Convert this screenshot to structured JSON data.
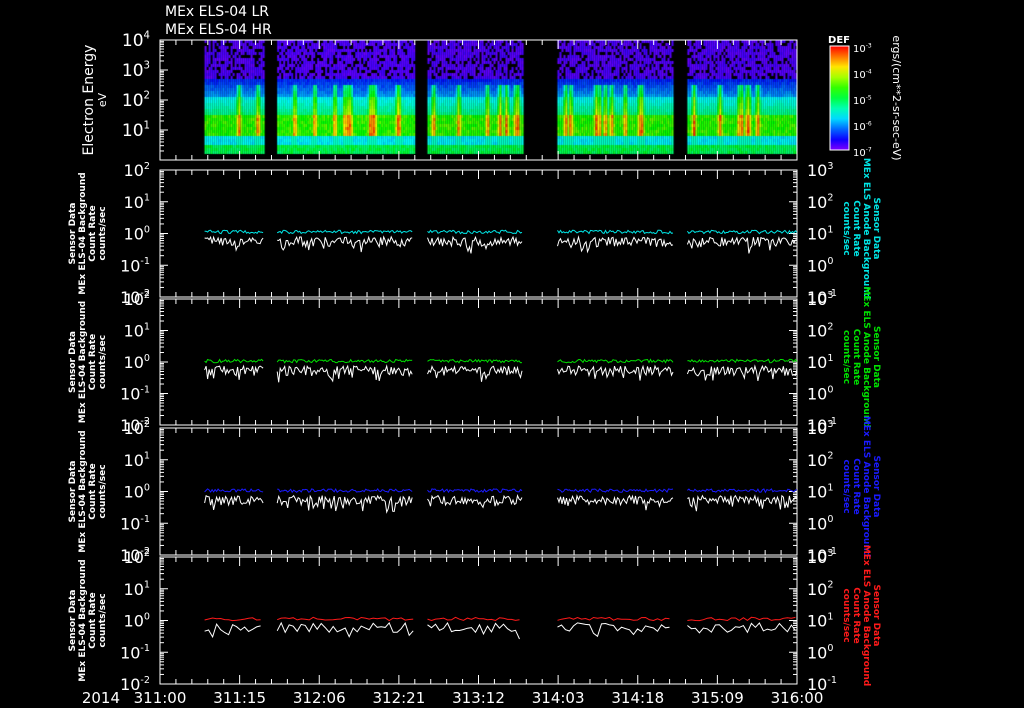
{
  "titles": [
    "MEx ELS-04 LR",
    "MEx ELS-04 HR"
  ],
  "colors": {
    "background": "#000000",
    "axis": "#ffffff",
    "background_series": "#ffffff"
  },
  "chart_data": [
    {
      "type": "heatmap",
      "name": "spectrogram",
      "ylabel": "Electron Energy",
      "yunits": "eV",
      "yscale": "log",
      "ylim": [
        1,
        10000
      ],
      "yticks": [
        "10^4",
        "10^3",
        "10^2",
        "10^1"
      ],
      "colorbar": {
        "label": "DEF",
        "units": "ergs/(cm**2-sr-sec-eV)",
        "range": [
          1e-07,
          0.001
        ],
        "ticks": [
          "10^-3",
          "10^-4",
          "10^-5",
          "10^-6",
          "10^-7"
        ]
      },
      "data_segments_doy": [
        [
          311.35,
          311.82
        ],
        [
          311.92,
          312.99
        ],
        [
          313.1,
          313.85
        ],
        [
          314.12,
          315.03
        ],
        [
          315.14,
          316.0
        ]
      ],
      "typical_levels": {
        "core_band_eV": [
          8,
          40
        ],
        "core_def": 1e-05,
        "upper_band_eV": [
          40,
          300
        ],
        "upper_def": 1e-06,
        "spike_peak_def": 0.001
      }
    },
    {
      "type": "line",
      "name": "panel-cyan",
      "left_label": [
        "Sensor Data",
        "MEx ELS-04 Background",
        "Count Rate",
        "counts/sec"
      ],
      "right_label": [
        "Sensor Data",
        "MEx ELS Anode Background",
        "Count Rate",
        "counts/sec"
      ],
      "color": "#00e5e5",
      "yscale": "log",
      "ylim": [
        0.01,
        100
      ],
      "yticks": [
        "10^2",
        "10^1",
        "10^0",
        "10^-1",
        "10^-2"
      ],
      "ylim_right": [
        0.1,
        1000
      ],
      "yticks_right": [
        "10^3",
        "10^2",
        "10^1",
        "10^0",
        "10^-1"
      ],
      "series": [
        {
          "name": "anode background",
          "level": 1.1
        },
        {
          "name": "ELS-04 background",
          "level": 0.65
        }
      ]
    },
    {
      "type": "line",
      "name": "panel-green",
      "left_label": [
        "Sensor Data",
        "MEx ELS-04 Background",
        "Count Rate",
        "counts/sec"
      ],
      "right_label": [
        "Sensor Data",
        "MEx ELS Anode Background",
        "Count Rate",
        "counts/sec"
      ],
      "color": "#00e000",
      "yscale": "log",
      "ylim": [
        0.01,
        100
      ],
      "yticks": [
        "10^2",
        "10^1",
        "10^0",
        "10^-1",
        "10^-2"
      ],
      "ylim_right": [
        0.1,
        1000
      ],
      "yticks_right": [
        "10^3",
        "10^2",
        "10^1",
        "10^0",
        "10^-1"
      ],
      "series": [
        {
          "name": "anode background",
          "level": 1.05
        },
        {
          "name": "ELS-04 background",
          "level": 0.62
        }
      ]
    },
    {
      "type": "line",
      "name": "panel-blue",
      "left_label": [
        "Sensor Data",
        "MEx ELS-04 Background",
        "Count Rate",
        "counts/sec"
      ],
      "right_label": [
        "Sensor Data",
        "MEx ELS Anode Background",
        "Count Rate",
        "counts/sec"
      ],
      "color": "#1a1aff",
      "yscale": "log",
      "ylim": [
        0.01,
        100
      ],
      "yticks": [
        "10^2",
        "10^1",
        "10^0",
        "10^-1",
        "10^-2"
      ],
      "ylim_right": [
        0.1,
        1000
      ],
      "yticks_right": [
        "10^3",
        "10^2",
        "10^1",
        "10^0",
        "10^-1"
      ],
      "series": [
        {
          "name": "anode background",
          "level": 1.05
        },
        {
          "name": "ELS-04 background",
          "level": 0.62
        }
      ]
    },
    {
      "type": "line",
      "name": "panel-red",
      "left_label": [
        "Sensor Data",
        "MEx ELS-04 Background",
        "Count Rate",
        "counts/sec"
      ],
      "right_label": [
        "Sensor Data",
        "MEx ELS Anode Background",
        "Count Rate",
        "counts/sec"
      ],
      "color": "#ff1a1a",
      "yscale": "log",
      "ylim": [
        0.01,
        100
      ],
      "yticks": [
        "10^2",
        "10^1",
        "10^0",
        "10^-1",
        "10^-2"
      ],
      "ylim_right": [
        0.1,
        1000
      ],
      "yticks_right": [
        "10^3",
        "10^2",
        "10^1",
        "10^0",
        "10^-1"
      ],
      "series": [
        {
          "name": "anode background",
          "level": 1.1
        },
        {
          "name": "ELS-04 background",
          "level": 0.7
        }
      ]
    }
  ],
  "xaxis": {
    "year": "2014",
    "range_doy": [
      311.0,
      316.0
    ],
    "ticks": [
      "311:00",
      "311:15",
      "312:06",
      "312:21",
      "313:12",
      "314:03",
      "314:18",
      "315:09",
      "316:00"
    ]
  }
}
